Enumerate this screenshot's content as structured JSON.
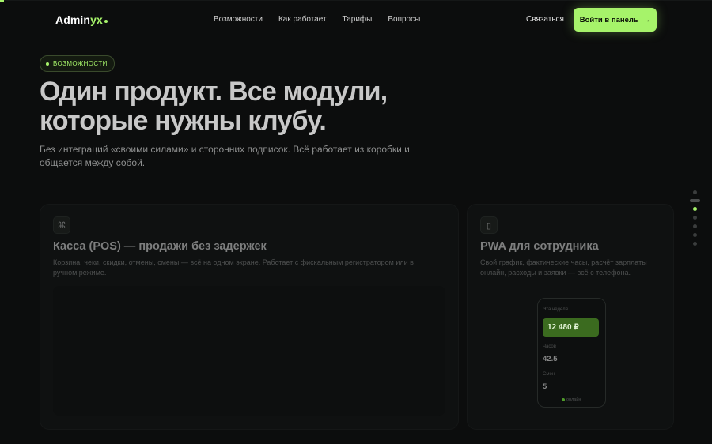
{
  "header": {
    "logo_main": "Admin",
    "logo_accent": "yx",
    "nav": [
      "Возможности",
      "Как работает",
      "Тарифы",
      "Вопросы"
    ],
    "contact": "Связаться",
    "cta_label": "Войти в панель",
    "cta_arrow": "→"
  },
  "hero": {
    "badge": "ВОЗМОЖНОСТИ",
    "title_line1": "Один продукт. Все модули,",
    "title_line2": "которые нужны клубу.",
    "subtitle": "Без интеграций «своими силами» и сторонних подписок. Всё работает из коробки и общается между собой."
  },
  "page_dots": {
    "count": 7,
    "active_index": 2
  },
  "cards": [
    {
      "icon": "command-icon",
      "icon_glyph": "⌘",
      "title": "Касса (POS) — продажи без задержек",
      "text": "Корзина, чеки, скидки, отмены, смены — всё на одном экране. Работает с фискальным регистратором или в ручном режиме."
    },
    {
      "icon": "phone-icon",
      "icon_glyph": "▯",
      "title": "PWA для сотрудника",
      "text": "Свой график, фактические часы, расчёт зарплаты онлайн, расходы и заявки — всё с телефона.",
      "phone": {
        "period_label": "Эта неделя",
        "amount": "12 480 ₽",
        "hours_label": "Часов",
        "hours_value": "42.5",
        "shifts_label": "Смен",
        "shifts_value": "5",
        "status": "онлайн"
      }
    }
  ],
  "colors": {
    "accent": "#a6f36a",
    "background": "#0c0d0d"
  }
}
